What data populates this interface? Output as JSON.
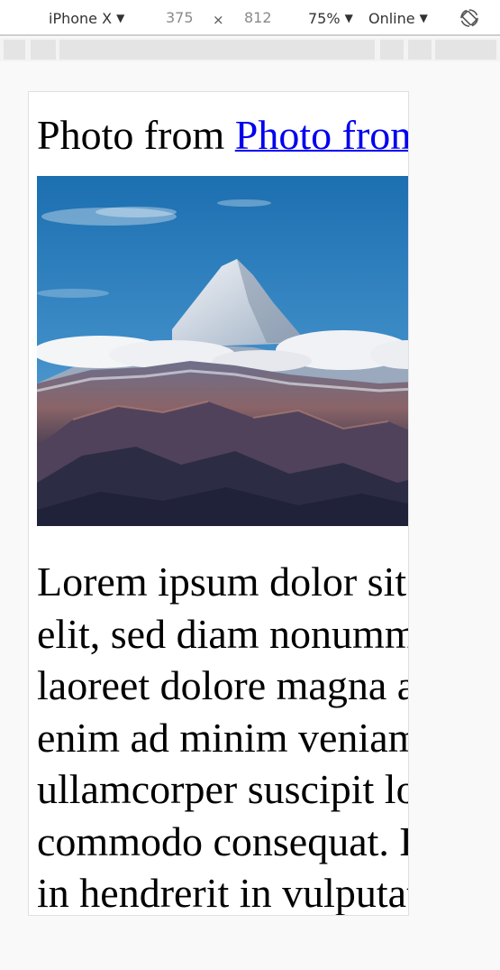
{
  "toolbar": {
    "device": "iPhone X",
    "width": "375",
    "times": "×",
    "height": "812",
    "zoom": "75%",
    "network": "Online"
  },
  "page": {
    "caption_prefix": "Photo from ",
    "caption_link": "Photo from Unsplash",
    "body_lines": [
      "Lorem ipsum dolor sit amet, consectetuer adipiscing",
      "elit, sed diam nonummy nibh euismod tincidunt ut",
      "laoreet dolore magna aliquam erat volutpat. Ut wisi",
      "enim ad minim veniam, quis nostrud exerci tation",
      "ullamcorper suscipit lobortis nisl ut aliquip ex ea",
      "commodo consequat. Duis autem vel eum iriure dolor",
      "in hendrerit in vulputate velit esse molestie consequat."
    ]
  },
  "colors": {
    "link": "#0000ee",
    "toolbar_bg": "#ffffff",
    "media_bar_bg": "#e4e4e4"
  },
  "icons": {
    "rotate": "rotate-icon",
    "caret": "caret-down-icon"
  }
}
